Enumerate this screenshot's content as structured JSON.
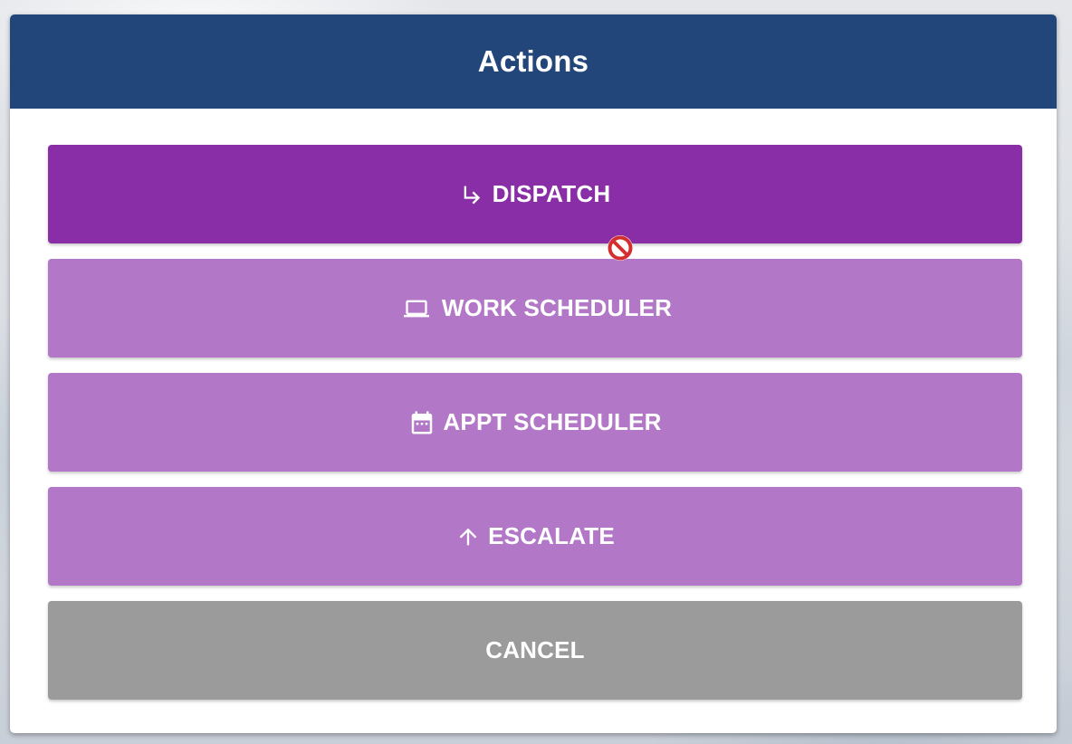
{
  "dialog": {
    "title": "Actions",
    "header_color": "#23467a"
  },
  "actions": [
    {
      "label": "DISPATCH",
      "icon": "subdirectory-arrow-right-icon",
      "color": "#8a2ea8",
      "state": "active"
    },
    {
      "label": "WORK SCHEDULER",
      "icon": "laptop-icon",
      "color": "#b277c6",
      "state": "disabled"
    },
    {
      "label": "APPT SCHEDULER",
      "icon": "calendar-icon",
      "color": "#b277c6",
      "state": "disabled"
    },
    {
      "label": "ESCALATE",
      "icon": "arrow-up-icon",
      "color": "#b277c6",
      "state": "disabled"
    }
  ],
  "cancel": {
    "label": "CANCEL",
    "color": "#9b9b9b"
  },
  "cursor": {
    "icon": "not-allowed-cursor-icon",
    "color": "#d32f2f"
  }
}
